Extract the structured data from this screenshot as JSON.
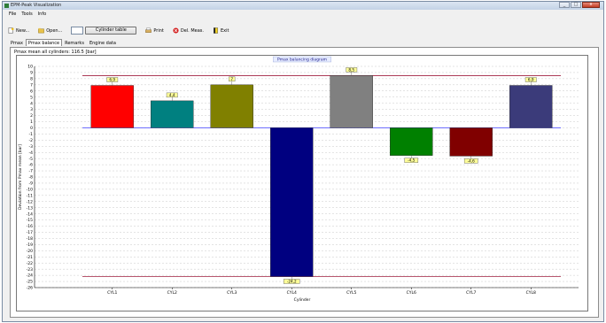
{
  "window": {
    "title": "EPM-Peak Visualization",
    "buttons": [
      "_",
      "□",
      "x"
    ]
  },
  "menu": {
    "items": [
      "File",
      "Tools",
      "Info"
    ]
  },
  "toolbar": {
    "new_label": "New...",
    "open_label": "Open...",
    "cylinder_table_label": "Cylinder table",
    "print_label": "Print",
    "del_meas_label": "Del. Meas.",
    "exit_label": "Exit"
  },
  "tabs": [
    {
      "label": "Pmax",
      "active": false
    },
    {
      "label": "Pmax balance",
      "active": true
    },
    {
      "label": "Remarks",
      "active": false
    },
    {
      "label": "Engine data",
      "active": false
    }
  ],
  "panel": {
    "pmax_mean_text": "Pmax mean all cylinders: 116.5 [bar]"
  },
  "chart_data": {
    "type": "bar",
    "title": "Pmax balancing diagram",
    "xlabel": "Cylinder",
    "ylabel": "Deviation from Pmax mean [bar]",
    "categories": [
      "CYL1",
      "CYL2",
      "CYL3",
      "CYL4",
      "CYL5",
      "CYL6",
      "CYL7",
      "CYL8"
    ],
    "values": [
      6.9,
      4.4,
      7,
      -24.2,
      8.5,
      -4.5,
      -4.6,
      6.9
    ],
    "labels": [
      "6,9",
      "4,4",
      "7",
      "-24,2",
      "8,5",
      "-4,5",
      "-4,6",
      "6,9"
    ],
    "colors": [
      "#ff0000",
      "#008080",
      "#808000",
      "#000080",
      "#808080",
      "#008000",
      "#800000",
      "#3b3b7a"
    ],
    "ylim": [
      -26,
      10
    ],
    "yticks": [
      10,
      9,
      8,
      7,
      6,
      5,
      4,
      3,
      2,
      1,
      0,
      -1,
      -2,
      -3,
      -4,
      -5,
      -6,
      -7,
      -8,
      -9,
      -10,
      -11,
      -12,
      -13,
      -14,
      -15,
      -16,
      -17,
      -18,
      -19,
      -20,
      -21,
      -22,
      -23,
      -24,
      -25,
      -26
    ],
    "reference_lines": [
      {
        "value": 8.5,
        "color": "#a02040"
      },
      {
        "value": 0,
        "color": "#5a5aff"
      },
      {
        "value": -24.2,
        "color": "#a02040"
      }
    ],
    "grid": true
  }
}
